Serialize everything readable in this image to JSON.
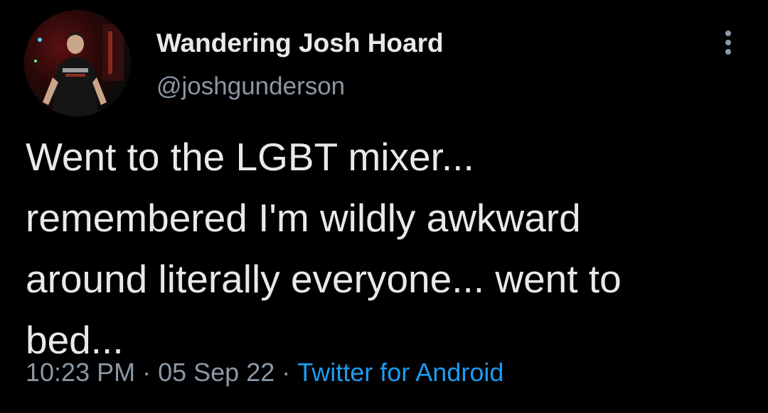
{
  "author": {
    "display_name": "Wandering Josh Hoard",
    "handle": "@joshgunderson",
    "avatar_icon": "profile-photo"
  },
  "tweet": {
    "lines": [
      "Went to the LGBT mixer...",
      "remembered I'm wildly awkward",
      "around literally everyone... went to",
      "bed..."
    ]
  },
  "meta": {
    "time": "10:23 PM",
    "separator": "·",
    "date": "05 Sep 22",
    "source": "Twitter for Android"
  },
  "actions": {
    "more_icon": "more-vertical-icon"
  },
  "colors": {
    "background": "#000000",
    "text": "#e7e9ea",
    "muted": "#8b98a5",
    "accent": "#1d9bf0"
  }
}
